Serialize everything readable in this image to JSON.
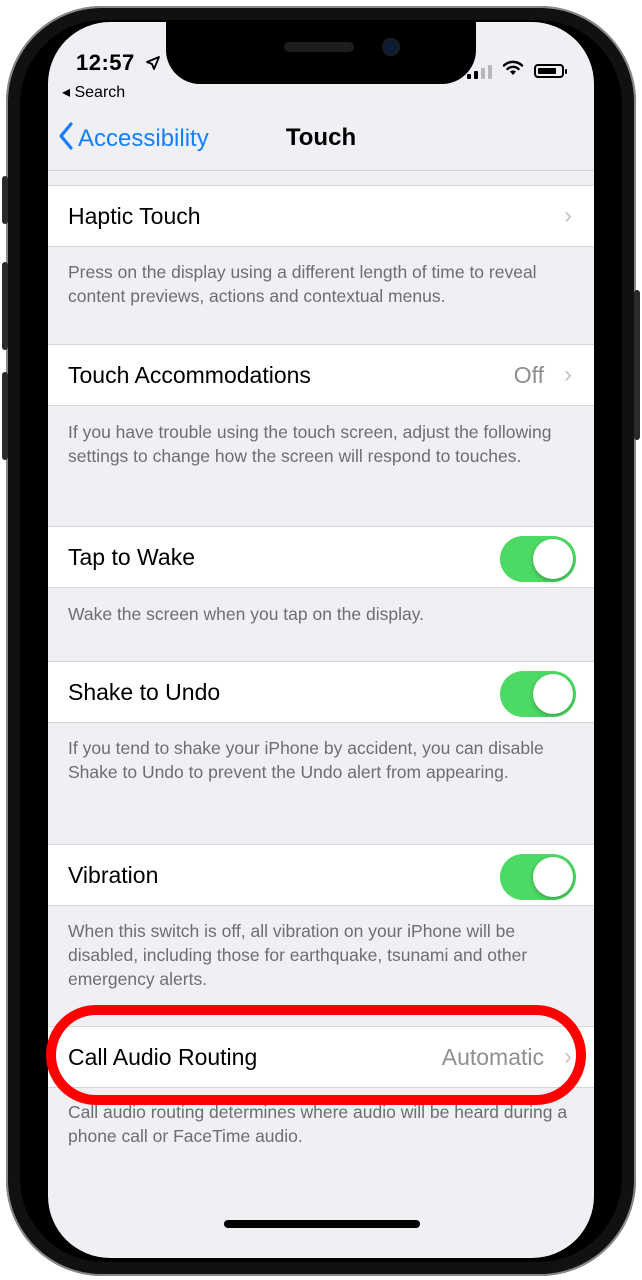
{
  "status_bar": {
    "time": "12:57",
    "back_app": "◂ Search"
  },
  "nav": {
    "back_label": "Accessibility",
    "title": "Touch"
  },
  "sections": [
    {
      "label": "Haptic Touch",
      "value": "",
      "control": "chevron",
      "footer": "Press on the display using a different length of time to reveal content previews, actions and contextual menus."
    },
    {
      "label": "Touch Accommodations",
      "value": "Off",
      "control": "chevron",
      "footer": "If you have trouble using the touch screen, adjust the following settings to change how the screen will respond to touches."
    },
    {
      "label": "Tap to Wake",
      "value": "",
      "control": "toggle",
      "on": true,
      "footer": "Wake the screen when you tap on the display."
    },
    {
      "label": "Shake to Undo",
      "value": "",
      "control": "toggle",
      "on": true,
      "footer": "If you tend to shake your iPhone by accident, you can disable Shake to Undo to prevent the Undo alert from appearing."
    },
    {
      "label": "Vibration",
      "value": "",
      "control": "toggle",
      "on": true,
      "footer": "When this switch is off, all vibration on your iPhone will be disabled, including those for earthquake, tsunami and other emergency alerts."
    },
    {
      "label": "Call Audio Routing",
      "value": "Automatic",
      "control": "chevron",
      "footer": "Call audio routing determines where audio will be heard during a phone call or FaceTime audio."
    }
  ],
  "colors": {
    "accent": "#147efb",
    "toggle_on": "#4cd964",
    "highlight": "#ff0000",
    "background": "#efeff4"
  }
}
